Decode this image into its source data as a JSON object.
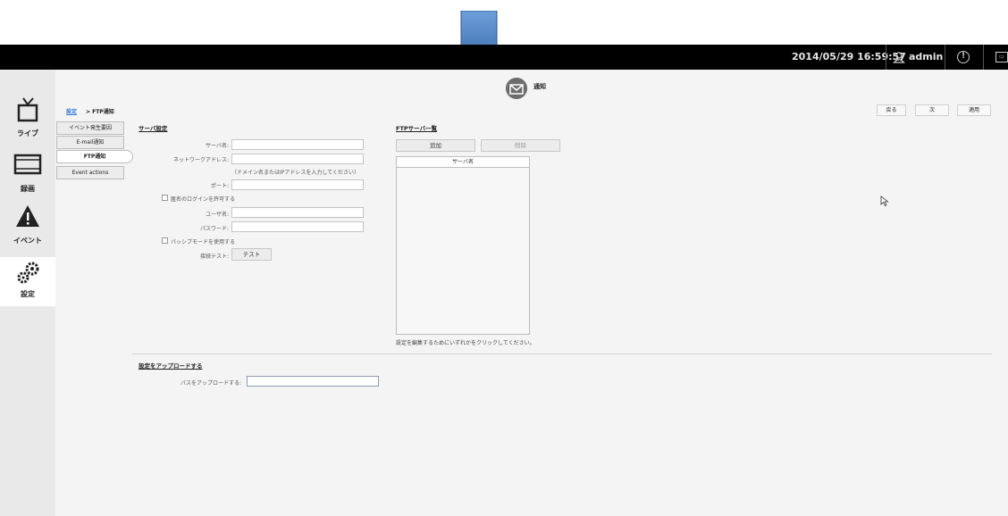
{
  "topbar": {
    "datetime": "2014/05/29 16:59:57",
    "user": "admin",
    "icons": [
      "user-icon",
      "alert-icon",
      "monitor-icon"
    ]
  },
  "leftnav": {
    "items": [
      {
        "label": "ライブ",
        "icon": "tv-icon"
      },
      {
        "label": "録画",
        "icon": "film-icon"
      },
      {
        "label": "イベント",
        "icon": "warning-icon"
      },
      {
        "label": "設定",
        "icon": "gear-icon"
      }
    ]
  },
  "header": {
    "title": "通知",
    "icon": "envelope-icon"
  },
  "breadcrumb": {
    "link": "設定",
    "current": "> FTP通知"
  },
  "actions": {
    "back": "戻る",
    "next": "次",
    "apply": "適用"
  },
  "subnav": {
    "items": [
      "イベント発生要因",
      "E-mail通知",
      "FTP通知",
      "Event actions"
    ]
  },
  "server_settings": {
    "title": "サーバ設定",
    "server_name_label": "サーバ名:",
    "server_name_value": "",
    "network_address_label": "ネットワークアドレス:",
    "network_address_value": "",
    "address_hint": "（ドメイン名またはIPアドレスを入力してください）",
    "port_label": "ポート:",
    "port_value": "",
    "anonymous_login_label": "匿名のログインを許可する",
    "username_label": "ユーザ名:",
    "username_value": "",
    "password_label": "パスワード:",
    "password_value": "",
    "passive_mode_label": "パッシブモードを使用する",
    "connection_test_label": "接続テスト:",
    "test_button": "テスト"
  },
  "ftp_server_list": {
    "title": "FTPサーバ一覧",
    "add_button": "追加",
    "delete_button": "削除",
    "column_header": "サーバ名",
    "rows": [],
    "note": "設定を編集するためにいずれかをクリックしてください。"
  },
  "upload_settings": {
    "title": "設定をアップロードする",
    "path_label": "パスをアップロードする:",
    "path_value": ""
  },
  "colors": {
    "topbar": "#000000",
    "accent_arrow": "#4a7ebf",
    "link": "#3a7bd5"
  }
}
